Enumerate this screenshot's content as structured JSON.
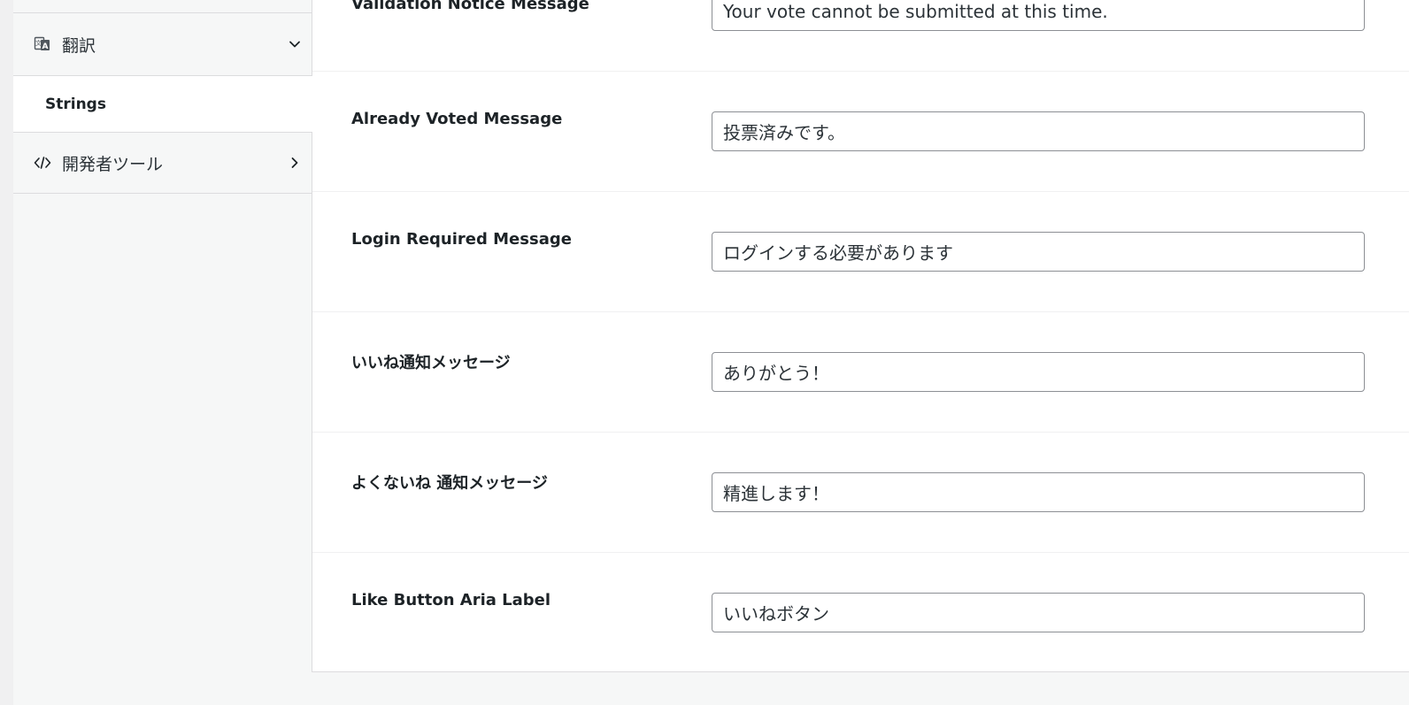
{
  "sidebar": {
    "translate_label": "翻訳",
    "strings_label": "Strings",
    "devtools_label": "開発者ツール"
  },
  "icons": {
    "translate": "translate-icon",
    "code": "code-icon",
    "chevron_down": "chevron-down-icon",
    "chevron_right": "chevron-right-icon"
  },
  "fields": [
    {
      "label": "Validation Notice Message",
      "value": "Your vote cannot be submitted at this time."
    },
    {
      "label": "Already Voted Message",
      "value": "投票済みです。"
    },
    {
      "label": "Login Required Message",
      "value": "ログインする必要があります"
    },
    {
      "label": "いいね通知メッセージ",
      "value": "ありがとう！"
    },
    {
      "label": "よくないね 通知メッセージ",
      "value": "精進します！"
    },
    {
      "label": "Like Button Aria Label",
      "value": "いいねボタン"
    }
  ]
}
